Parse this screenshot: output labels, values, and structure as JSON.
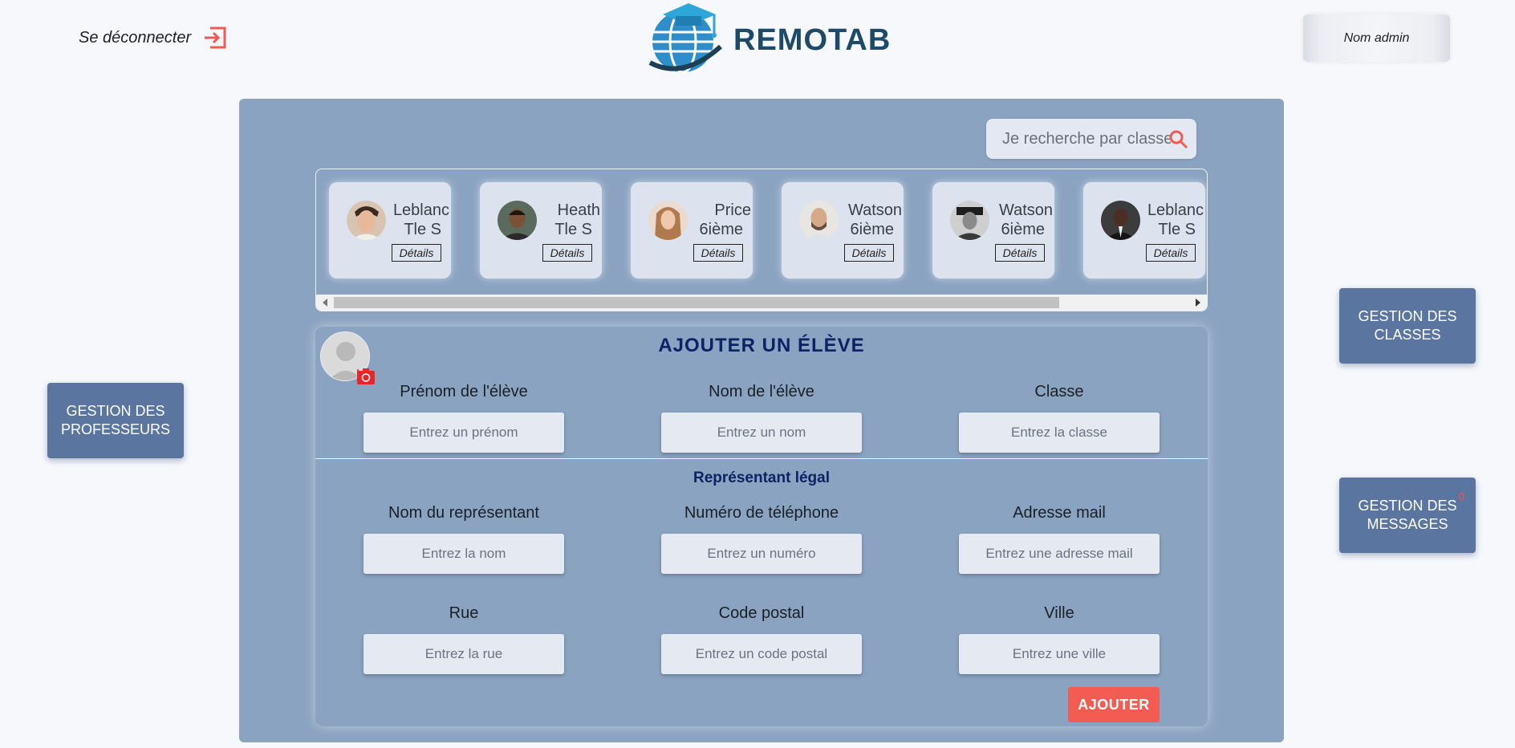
{
  "header": {
    "logout_label": "Se déconnecter",
    "logo_text": "REMOTAB",
    "admin_label": "Nom admin"
  },
  "side_buttons": {
    "professeurs": "GESTION DES PROFESSEURS",
    "classes": "GESTION DES CLASSES",
    "messages": "GESTION DES MESSAGES",
    "messages_count": "0"
  },
  "search": {
    "placeholder": "Je recherche par classe"
  },
  "students": [
    {
      "name": "Leblanc",
      "class": "Tle S",
      "details": "Détails"
    },
    {
      "name": "Heath",
      "class": "Tle S",
      "details": "Détails"
    },
    {
      "name": "Price",
      "class": "6ième",
      "details": "Détails"
    },
    {
      "name": "Watson",
      "class": "6ième",
      "details": "Détails"
    },
    {
      "name": "Watson",
      "class": "6ième",
      "details": "Détails"
    },
    {
      "name": "Leblanc",
      "class": "Tle S",
      "details": "Détails"
    }
  ],
  "form": {
    "title": "AJOUTER UN ÉLÈVE",
    "student": {
      "firstname_label": "Prénom de l'élève",
      "firstname_placeholder": "Entrez un prénom",
      "lastname_label": "Nom de l'élève",
      "lastname_placeholder": "Entrez un nom",
      "class_label": "Classe",
      "class_placeholder": "Entrez la classe"
    },
    "legal_title": "Représentant légal",
    "legal": {
      "name_label": "Nom du représentant",
      "name_placeholder": "Entrez la nom",
      "phone_label": "Numéro de téléphone",
      "phone_placeholder": "Entrez un numéro",
      "email_label": "Adresse mail",
      "email_placeholder": "Entrez une adresse mail",
      "street_label": "Rue",
      "street_placeholder": "Entrez la rue",
      "zip_label": "Code postal",
      "zip_placeholder": "Entrez un code postal",
      "city_label": "Ville",
      "city_placeholder": "Entrez une ville"
    },
    "submit_label": "AJOUTER"
  },
  "colors": {
    "panel": "#8aa3c1",
    "side_button": "#5a76a0",
    "title": "#0d2266",
    "accent": "#f25c52"
  }
}
